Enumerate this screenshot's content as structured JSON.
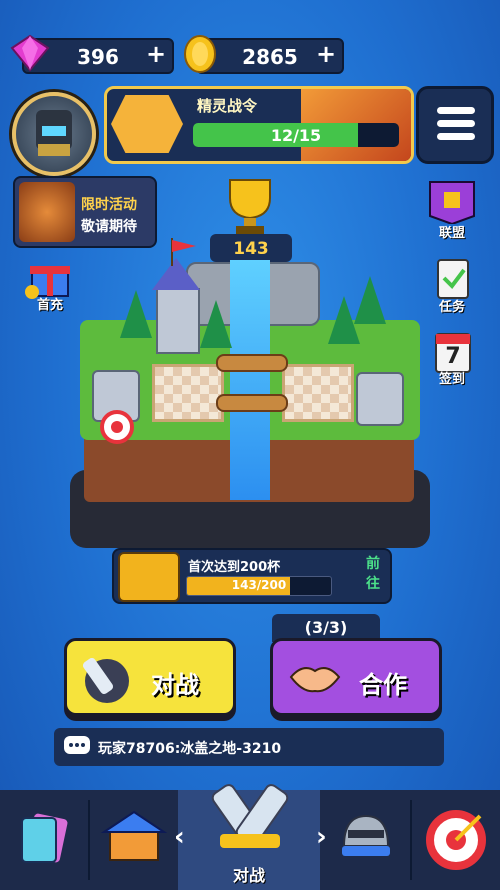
{
  "currency": {
    "gems": "396",
    "coins": "2865",
    "plus": "+"
  },
  "pass": {
    "title": "精灵战令",
    "progress_text": "12/15",
    "progress": 0.8
  },
  "event": {
    "line1": "限时活动",
    "line2": "敬请期待"
  },
  "side_left": {
    "first_recharge": "首充"
  },
  "side_right": {
    "alliance": "联盟",
    "tasks": "任务",
    "checkin": "签到",
    "calendar_day": "7"
  },
  "trophies": "143",
  "quest": {
    "title": "首次达到200杯",
    "progress_text": "143/200",
    "progress": 0.715,
    "go": "前往"
  },
  "battle": {
    "battle_label": "对战",
    "coop_label": "合作",
    "coop_count": "(3/3)"
  },
  "chat": {
    "message": "玩家78706:冰盖之地-3210"
  },
  "nav": {
    "selected_label": "对战",
    "left_arrow": "‹",
    "right_arrow": "›"
  },
  "colors": {
    "background": "#1f6fd0",
    "battle_button": "#f6e33c",
    "coop_button": "#a34fe0",
    "progress_green": "#44c44a",
    "gold": "#f2b31d"
  }
}
